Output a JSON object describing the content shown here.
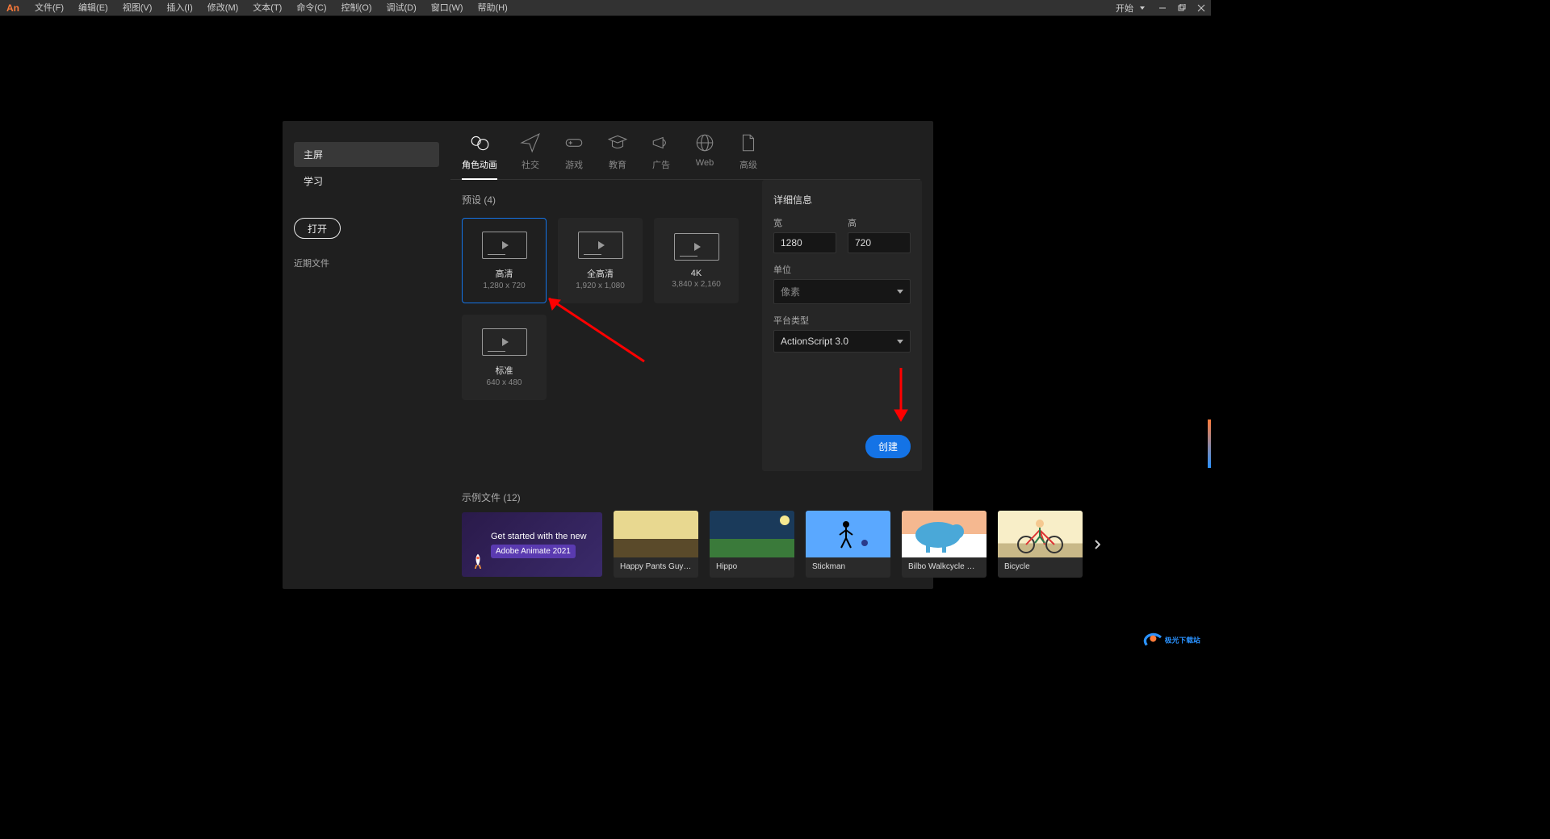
{
  "app": {
    "logo": "An"
  },
  "menubar": {
    "items": [
      "文件(F)",
      "编辑(E)",
      "视图(V)",
      "插入(I)",
      "修改(M)",
      "文本(T)",
      "命令(C)",
      "控制(O)",
      "调试(D)",
      "窗口(W)",
      "帮助(H)"
    ],
    "start_label": "开始"
  },
  "sidebar": {
    "home": "主屏",
    "learn": "学习",
    "open": "打开",
    "recent": "近期文件"
  },
  "tabs": [
    {
      "label": "角色动画"
    },
    {
      "label": "社交"
    },
    {
      "label": "游戏"
    },
    {
      "label": "教育"
    },
    {
      "label": "广告"
    },
    {
      "label": "Web"
    },
    {
      "label": "高级"
    }
  ],
  "presets": {
    "title": "预设 (4)",
    "items": [
      {
        "name": "高清",
        "dims": "1,280 x 720"
      },
      {
        "name": "全高清",
        "dims": "1,920 x 1,080"
      },
      {
        "name": "4K",
        "dims": "3,840 x 2,160"
      },
      {
        "name": "标准",
        "dims": "640 x 480"
      }
    ]
  },
  "details": {
    "title": "详细信息",
    "width_label": "宽",
    "height_label": "高",
    "width_value": "1280",
    "height_value": "720",
    "units_label": "单位",
    "units_value": "像素",
    "platform_label": "平台类型",
    "platform_value": "ActionScript 3.0",
    "create": "创建"
  },
  "samples": {
    "title": "示例文件 (12)",
    "hero_line1": "Get started with the new",
    "hero_line2": "Adobe Animate 2021",
    "items": [
      {
        "name": "Happy Pants Guy Dance"
      },
      {
        "name": "Hippo"
      },
      {
        "name": "Stickman"
      },
      {
        "name": "Bilbo Walkcycle Side"
      },
      {
        "name": "Bicycle"
      }
    ]
  },
  "watermark": "极光下载站"
}
